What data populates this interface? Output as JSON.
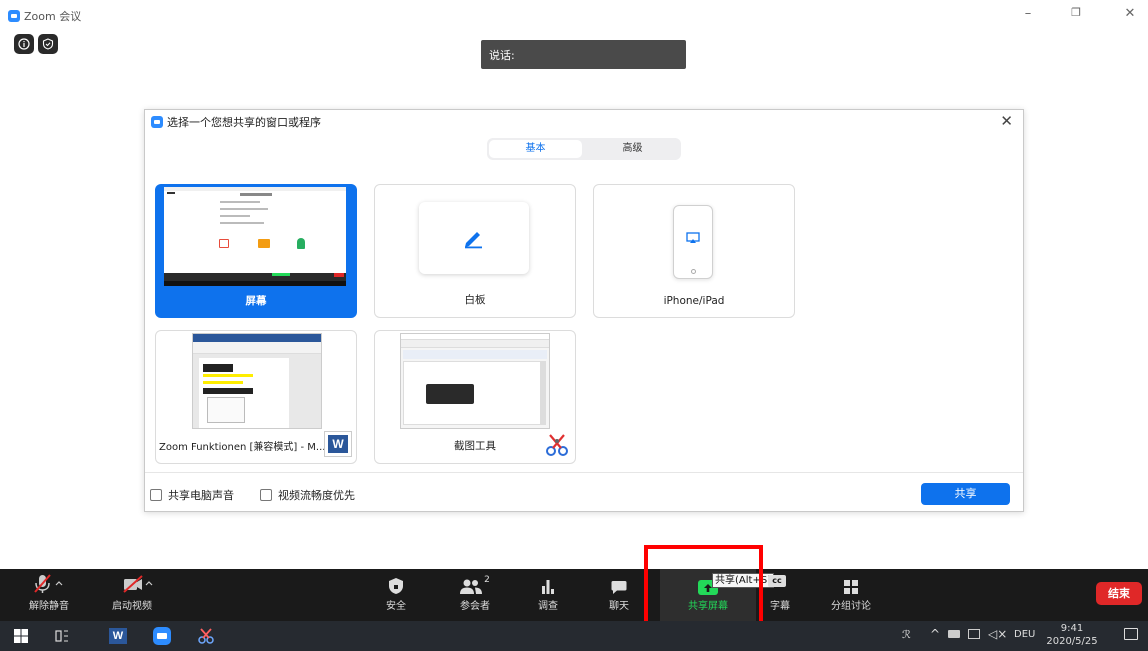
{
  "app": {
    "title": "Zoom 会议"
  },
  "speaker": {
    "label": "说话:"
  },
  "dialog": {
    "title": "选择一个您想共享的窗口或程序",
    "tabs": [
      {
        "label": "基本",
        "active": true
      },
      {
        "label": "高级",
        "active": false
      }
    ],
    "tiles": [
      {
        "label": "屏幕",
        "selected": true
      },
      {
        "label": "白板",
        "selected": false
      },
      {
        "label": "iPhone/iPad",
        "selected": false
      },
      {
        "label": "Zoom Funktionen [兼容模式] - M...",
        "selected": false
      },
      {
        "label": "截图工具",
        "selected": false
      }
    ],
    "options": {
      "computer_audio": "共享电脑声音",
      "optimize_video": "视频流畅度优先"
    },
    "share_button": "共享"
  },
  "toolbar": {
    "unmute": "解除静音",
    "start_video": "启动视频",
    "security": "安全",
    "participants": "参会者",
    "participants_count": "2",
    "polls": "调查",
    "chat": "聊天",
    "share_screen": "共享屏幕",
    "share_tooltip": "共享(Alt+S)",
    "captions": "字幕",
    "breakout": "分组讨论",
    "end": "结束"
  },
  "taskbar": {
    "time": "9:41",
    "date": "2020/5/25",
    "lang": "DEU"
  },
  "colors": {
    "accent": "#0e72ed",
    "share_green": "#23d959",
    "end_red": "#e02828",
    "highlight": "#ff0000"
  }
}
